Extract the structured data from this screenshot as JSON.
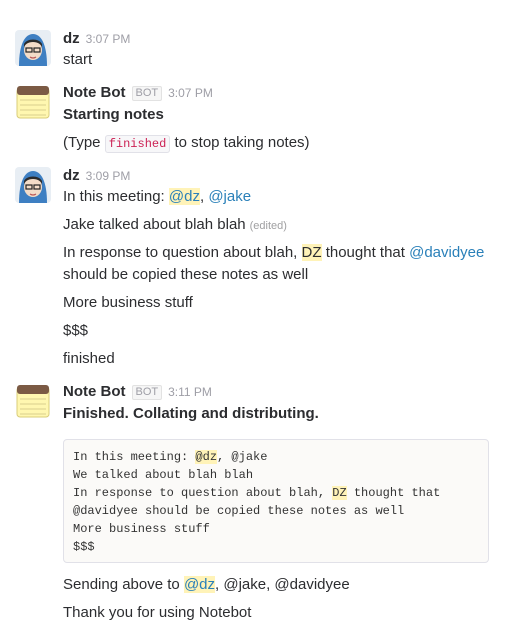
{
  "messages": [
    {
      "author": "dz",
      "time": "3:07 PM",
      "lines": [
        "start"
      ]
    },
    {
      "author": "Note Bot",
      "bot_badge": "BOT",
      "time": "3:07 PM",
      "title": "Starting notes",
      "type_hint": {
        "prefix": "(Type",
        "code": "finished",
        "suffix": "to stop taking notes)"
      }
    },
    {
      "author": "dz",
      "time": "3:09 PM",
      "meeting_line": {
        "prefix": "In this meeting:",
        "m1": "@dz",
        "sep": ",",
        "m2": "@jake"
      },
      "jake_line": {
        "text": "Jake talked about blah blah",
        "edited": "(edited)"
      },
      "response_line": {
        "prefix": "In response to question about blah,",
        "hl": "DZ",
        "mid": "thought that",
        "mention": "@davidyee",
        "line2": "should be copied these notes as well"
      },
      "more": "More business stuff",
      "dollars": "$$$",
      "finished": "finished"
    },
    {
      "author": "Note Bot",
      "bot_badge": "BOT",
      "time": "3:11 PM",
      "title": "Finished. Collating and distributing.",
      "code_block": {
        "l1_prefix": "In this meeting:",
        "l1_hl": "@dz",
        "l1_suffix": ", @jake",
        "l2": "We talked about blah blah",
        "l3_prefix": "In response to question about blah,",
        "l3_hl": "DZ",
        "l3_suffix": "thought that",
        "l4": "@davidyee should be copied these notes as well",
        "l5": "More business stuff",
        "l6": "$$$"
      },
      "sending": {
        "prefix": "Sending above to",
        "hl": "@dz",
        "rest": ", @jake, @davidyee"
      },
      "thanks": "Thank you for using Notebot"
    }
  ],
  "colors": {
    "mention": "#2a80b9",
    "highlight": "#fff3b8",
    "code_red": "#cc2255"
  },
  "icons": {
    "user_avatar": "blue-hooded-avatar-icon",
    "bot_avatar": "notepad-icon"
  }
}
